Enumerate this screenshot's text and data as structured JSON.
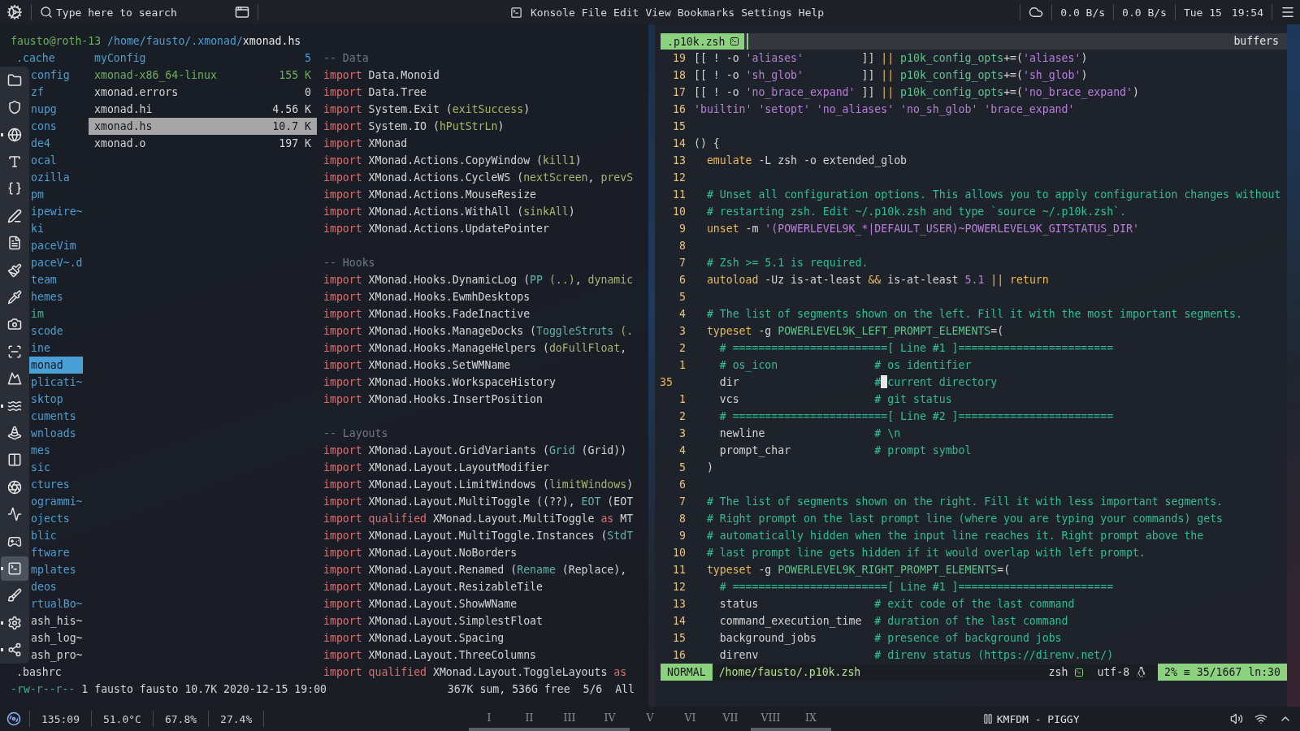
{
  "top_bar": {
    "search": {
      "placeholder": "Type here to search"
    },
    "app": "Konsole",
    "menu": [
      "File",
      "Edit",
      "View",
      "Bookmarks",
      "Settings",
      "Help"
    ],
    "net_down": "0.0 B/s",
    "net_up": "0.0 B/s",
    "date": "Tue 15",
    "time": "19:54"
  },
  "ranger": {
    "header": [
      {
        "kind": "user",
        "text": "fausto@roth-13"
      },
      {
        "kind": "path",
        "text": " /home/fausto/.xmonad/"
      },
      {
        "kind": "file",
        "text": "xmonad.hs"
      }
    ],
    "parent": [
      {
        "name": ".cache",
        "kind": "dir",
        "selected": false
      },
      {
        "name": "config",
        "kind": "dir",
        "selected": false
      },
      {
        "name": "zf",
        "kind": "dir",
        "selected": false
      },
      {
        "name": "nupg",
        "kind": "dir",
        "selected": false
      },
      {
        "name": "cons",
        "kind": "dir",
        "selected": false
      },
      {
        "name": "de4",
        "kind": "dir",
        "selected": false
      },
      {
        "name": "ocal",
        "kind": "dir",
        "selected": false
      },
      {
        "name": "ozilla",
        "kind": "dir",
        "selected": false
      },
      {
        "name": "pm",
        "kind": "dir",
        "selected": false
      },
      {
        "name": "ipewire~",
        "kind": "dir",
        "selected": false
      },
      {
        "name": "ki",
        "kind": "dir",
        "selected": false
      },
      {
        "name": "paceVim",
        "kind": "dir",
        "selected": false
      },
      {
        "name": "paceV~.d",
        "kind": "dir",
        "selected": false
      },
      {
        "name": "team",
        "kind": "dir",
        "selected": false
      },
      {
        "name": "hemes",
        "kind": "dir",
        "selected": false
      },
      {
        "name": "im",
        "kind": "link",
        "selected": false
      },
      {
        "name": "scode",
        "kind": "dir",
        "selected": false
      },
      {
        "name": "ine",
        "kind": "dir",
        "selected": false
      },
      {
        "name": "monad",
        "kind": "dir",
        "selected": true
      },
      {
        "name": "plicati~",
        "kind": "dir",
        "selected": false
      },
      {
        "name": "sktop",
        "kind": "dir",
        "selected": false
      },
      {
        "name": "cuments",
        "kind": "dir",
        "selected": false
      },
      {
        "name": "wnloads",
        "kind": "dir",
        "selected": false
      },
      {
        "name": "mes",
        "kind": "dir",
        "selected": false
      },
      {
        "name": "sic",
        "kind": "dir",
        "selected": false
      },
      {
        "name": "ctures",
        "kind": "dir",
        "selected": false
      },
      {
        "name": "ogrammi~",
        "kind": "dir",
        "selected": false
      },
      {
        "name": "ojects",
        "kind": "dir",
        "selected": false
      },
      {
        "name": "blic",
        "kind": "dir",
        "selected": false
      },
      {
        "name": "ftware",
        "kind": "dir",
        "selected": false
      },
      {
        "name": "mplates",
        "kind": "dir",
        "selected": false
      },
      {
        "name": "deos",
        "kind": "dir",
        "selected": false
      },
      {
        "name": "rtualBo~",
        "kind": "dir",
        "selected": false
      },
      {
        "name": "ash_his~",
        "kind": "file",
        "selected": false
      },
      {
        "name": "ash_log~",
        "kind": "file",
        "selected": false
      },
      {
        "name": "ash_pro~",
        "kind": "file",
        "selected": false
      },
      {
        "name": ".bashrc",
        "kind": "file",
        "selected": false
      }
    ],
    "dock": [
      {
        "selected": false,
        "running": false
      },
      {
        "selected": false,
        "running": false
      },
      {
        "selected": false,
        "running": true
      },
      {
        "selected": false,
        "running": false
      },
      {
        "selected": false,
        "running": false
      },
      {
        "selected": false,
        "running": false
      },
      {
        "selected": false,
        "running": false
      },
      {
        "selected": false,
        "running": false
      },
      {
        "selected": false,
        "running": false
      },
      {
        "selected": false,
        "running": false
      },
      {
        "selected": false,
        "running": false
      },
      {
        "selected": false,
        "running": false
      },
      {
        "selected": false,
        "running": true
      },
      {
        "selected": false,
        "running": false
      },
      {
        "selected": false,
        "running": false
      },
      {
        "selected": false,
        "running": false
      },
      {
        "selected": false,
        "running": false
      },
      {
        "selected": false,
        "running": false
      },
      {
        "selected": true,
        "running": true
      },
      {
        "selected": false,
        "running": false
      },
      {
        "selected": false,
        "running": true
      },
      {
        "selected": false,
        "running": true
      }
    ],
    "files": [
      {
        "name": "myConfig",
        "size": "5",
        "kind": "dir",
        "selected": false
      },
      {
        "name": "xmonad-x86_64-linux",
        "size": "155 K",
        "kind": "exec",
        "selected": false
      },
      {
        "name": "xmonad.errors",
        "size": "0",
        "kind": "file",
        "selected": false
      },
      {
        "name": "xmonad.hi",
        "size": "4.56 K",
        "kind": "file",
        "selected": false
      },
      {
        "name": "xmonad.hs",
        "size": "10.7 K",
        "kind": "file",
        "selected": true
      },
      {
        "name": "xmonad.o",
        "size": "197 K",
        "kind": "file",
        "selected": false
      }
    ],
    "preview": [
      {
        "kind": "code",
        "segs": [
          {
            "kind": "com",
            "text": "-- Data"
          }
        ]
      },
      {
        "kind": "code",
        "segs": [
          {
            "kind": "kw",
            "text": "import"
          },
          {
            "kind": "plain",
            "text": " Data.Monoid"
          }
        ]
      },
      {
        "kind": "code",
        "segs": [
          {
            "kind": "kw",
            "text": "import"
          },
          {
            "kind": "plain",
            "text": " Data.Tree"
          }
        ]
      },
      {
        "kind": "code",
        "segs": [
          {
            "kind": "kw",
            "text": "import"
          },
          {
            "kind": "plain",
            "text": " System.Exit ("
          },
          {
            "kind": "fn",
            "text": "exitSuccess"
          },
          {
            "kind": "plain",
            "text": ")"
          }
        ]
      },
      {
        "kind": "code",
        "segs": [
          {
            "kind": "kw",
            "text": "import"
          },
          {
            "kind": "plain",
            "text": " System.IO ("
          },
          {
            "kind": "fn",
            "text": "hPutStrLn"
          },
          {
            "kind": "plain",
            "text": ")"
          }
        ]
      },
      {
        "kind": "code",
        "segs": [
          {
            "kind": "kw",
            "text": "import"
          },
          {
            "kind": "plain",
            "text": " XMonad"
          }
        ]
      },
      {
        "kind": "code",
        "segs": [
          {
            "kind": "kw",
            "text": "import"
          },
          {
            "kind": "plain",
            "text": " XMonad.Actions.CopyWindow ("
          },
          {
            "kind": "fn",
            "text": "kill1"
          },
          {
            "kind": "plain",
            "text": ")"
          }
        ]
      },
      {
        "kind": "code",
        "segs": [
          {
            "kind": "kw",
            "text": "import"
          },
          {
            "kind": "plain",
            "text": " XMonad.Actions.CycleWS ("
          },
          {
            "kind": "fn",
            "text": "nextScreen"
          },
          {
            "kind": "plain",
            "text": ", "
          },
          {
            "kind": "fn",
            "text": "prevS"
          }
        ]
      },
      {
        "kind": "code",
        "segs": [
          {
            "kind": "kw",
            "text": "import"
          },
          {
            "kind": "plain",
            "text": " XMonad.Actions.MouseResize"
          }
        ]
      },
      {
        "kind": "code",
        "segs": [
          {
            "kind": "kw",
            "text": "import"
          },
          {
            "kind": "plain",
            "text": " XMonad.Actions.WithAll ("
          },
          {
            "kind": "fn",
            "text": "sinkAll"
          },
          {
            "kind": "plain",
            "text": ")"
          }
        ]
      },
      {
        "kind": "code",
        "segs": [
          {
            "kind": "kw",
            "text": "import"
          },
          {
            "kind": "plain",
            "text": " XMonad.Actions.UpdatePointer"
          }
        ]
      },
      {
        "kind": "blank"
      },
      {
        "kind": "code",
        "segs": [
          {
            "kind": "com",
            "text": "-- Hooks"
          }
        ]
      },
      {
        "kind": "code",
        "segs": [
          {
            "kind": "kw",
            "text": "import"
          },
          {
            "kind": "plain",
            "text": " XMonad.Hooks.DynamicLog ("
          },
          {
            "kind": "ctor",
            "text": "PP"
          },
          {
            "kind": "fn",
            "text": " (..)"
          },
          {
            "kind": "plain",
            "text": ", "
          },
          {
            "kind": "fn",
            "text": "dynamic"
          }
        ]
      },
      {
        "kind": "code",
        "segs": [
          {
            "kind": "kw",
            "text": "import"
          },
          {
            "kind": "plain",
            "text": " XMonad.Hooks.EwmhDesktops"
          }
        ]
      },
      {
        "kind": "code",
        "segs": [
          {
            "kind": "kw",
            "text": "import"
          },
          {
            "kind": "plain",
            "text": " XMonad.Hooks.FadeInactive"
          }
        ]
      },
      {
        "kind": "code",
        "segs": [
          {
            "kind": "kw",
            "text": "import"
          },
          {
            "kind": "plain",
            "text": " XMonad.Hooks.ManageDocks ("
          },
          {
            "kind": "ctor",
            "text": "ToggleStruts"
          },
          {
            "kind": "fn",
            "text": " (."
          }
        ]
      },
      {
        "kind": "code",
        "segs": [
          {
            "kind": "kw",
            "text": "import"
          },
          {
            "kind": "plain",
            "text": " XMonad.Hooks.ManageHelpers ("
          },
          {
            "kind": "fn",
            "text": "doFullFloat"
          },
          {
            "kind": "plain",
            "text": ","
          }
        ]
      },
      {
        "kind": "code",
        "segs": [
          {
            "kind": "kw",
            "text": "import"
          },
          {
            "kind": "plain",
            "text": " XMonad.Hooks.SetWMName"
          }
        ]
      },
      {
        "kind": "code",
        "segs": [
          {
            "kind": "kw",
            "text": "import"
          },
          {
            "kind": "plain",
            "text": " XMonad.Hooks.WorkspaceHistory"
          }
        ]
      },
      {
        "kind": "code",
        "segs": [
          {
            "kind": "kw",
            "text": "import"
          },
          {
            "kind": "plain",
            "text": " XMonad.Hooks.InsertPosition"
          }
        ]
      },
      {
        "kind": "blank"
      },
      {
        "kind": "code",
        "segs": [
          {
            "kind": "com",
            "text": "-- Layouts"
          }
        ]
      },
      {
        "kind": "code",
        "segs": [
          {
            "kind": "kw",
            "text": "import"
          },
          {
            "kind": "plain",
            "text": " XMonad.Layout.GridVariants ("
          },
          {
            "kind": "ctor",
            "text": "Grid"
          },
          {
            "kind": "plain",
            "text": " (Grid))"
          }
        ]
      },
      {
        "kind": "code",
        "segs": [
          {
            "kind": "kw",
            "text": "import"
          },
          {
            "kind": "plain",
            "text": " XMonad.Layout.LayoutModifier"
          }
        ]
      },
      {
        "kind": "code",
        "segs": [
          {
            "kind": "kw",
            "text": "import"
          },
          {
            "kind": "plain",
            "text": " XMonad.Layout.LimitWindows ("
          },
          {
            "kind": "fn",
            "text": "limitWindows"
          },
          {
            "kind": "plain",
            "text": ")"
          }
        ]
      },
      {
        "kind": "code",
        "segs": [
          {
            "kind": "kw",
            "text": "import"
          },
          {
            "kind": "plain",
            "text": " XMonad.Layout.MultiToggle ((??), "
          },
          {
            "kind": "ctor",
            "text": "EOT"
          },
          {
            "kind": "plain",
            "text": " (EOT"
          }
        ]
      },
      {
        "kind": "code",
        "segs": [
          {
            "kind": "kw",
            "text": "import qualified"
          },
          {
            "kind": "plain",
            "text": " XMonad.Layout.MultiToggle "
          },
          {
            "kind": "kw",
            "text": "as"
          },
          {
            "kind": "plain",
            "text": " MT"
          }
        ]
      },
      {
        "kind": "code",
        "segs": [
          {
            "kind": "kw",
            "text": "import"
          },
          {
            "kind": "plain",
            "text": " XMonad.Layout.MultiToggle.Instances ("
          },
          {
            "kind": "ctor",
            "text": "StdT"
          }
        ]
      },
      {
        "kind": "code",
        "segs": [
          {
            "kind": "kw",
            "text": "import"
          },
          {
            "kind": "plain",
            "text": " XMonad.Layout.NoBorders"
          }
        ]
      },
      {
        "kind": "code",
        "segs": [
          {
            "kind": "kw",
            "text": "import"
          },
          {
            "kind": "plain",
            "text": " XMonad.Layout.Renamed ("
          },
          {
            "kind": "ctor",
            "text": "Rename"
          },
          {
            "kind": "plain",
            "text": " (Replace),"
          }
        ]
      },
      {
        "kind": "code",
        "segs": [
          {
            "kind": "kw",
            "text": "import"
          },
          {
            "kind": "plain",
            "text": " XMonad.Layout.ResizableTile"
          }
        ]
      },
      {
        "kind": "code",
        "segs": [
          {
            "kind": "kw",
            "text": "import"
          },
          {
            "kind": "plain",
            "text": " XMonad.Layout.ShowWName"
          }
        ]
      },
      {
        "kind": "code",
        "segs": [
          {
            "kind": "kw",
            "text": "import"
          },
          {
            "kind": "plain",
            "text": " XMonad.Layout.SimplestFloat"
          }
        ]
      },
      {
        "kind": "code",
        "segs": [
          {
            "kind": "kw",
            "text": "import"
          },
          {
            "kind": "plain",
            "text": " XMonad.Layout.Spacing"
          }
        ]
      },
      {
        "kind": "code",
        "segs": [
          {
            "kind": "kw",
            "text": "import"
          },
          {
            "kind": "plain",
            "text": " XMonad.Layout.ThreeColumns"
          }
        ]
      },
      {
        "kind": "code",
        "segs": [
          {
            "kind": "kw",
            "text": "import qualified"
          },
          {
            "kind": "plain",
            "text": " XMonad.Layout.ToggleLayouts "
          },
          {
            "kind": "kw",
            "text": "as"
          }
        ]
      }
    ],
    "status": {
      "left": [
        {
          "kind": "perm",
          "text": "-rw-r--r--"
        },
        {
          "kind": "plain",
          "text": " 1 fausto fausto 10.7K 2020-12-15 19:00"
        }
      ],
      "right": "367K sum, 536G free  5/6  All"
    }
  },
  "vim": {
    "tab": ".p10k.zsh",
    "buffers": "buffers",
    "lines": [
      {
        "num": "19",
        "current": false,
        "kind": "code",
        "segs": [
          {
            "kind": "plain",
            "text": "[[ ! -o "
          },
          {
            "kind": "str",
            "text": "'aliases'"
          },
          {
            "kind": "plain",
            "text": "         ]] "
          },
          {
            "kind": "op",
            "text": "|| "
          },
          {
            "kind": "var",
            "text": "p10k_config_opts"
          },
          {
            "kind": "plain",
            "text": "+=("
          },
          {
            "kind": "str",
            "text": "'aliases'"
          },
          {
            "kind": "plain",
            "text": ")"
          }
        ]
      },
      {
        "num": "18",
        "current": false,
        "kind": "code",
        "segs": [
          {
            "kind": "plain",
            "text": "[[ ! -o "
          },
          {
            "kind": "str",
            "text": "'sh_glob'"
          },
          {
            "kind": "plain",
            "text": "         ]] "
          },
          {
            "kind": "op",
            "text": "|| "
          },
          {
            "kind": "var",
            "text": "p10k_config_opts"
          },
          {
            "kind": "plain",
            "text": "+=("
          },
          {
            "kind": "str",
            "text": "'sh_glob'"
          },
          {
            "kind": "plain",
            "text": ")"
          }
        ]
      },
      {
        "num": "17",
        "current": false,
        "kind": "code",
        "segs": [
          {
            "kind": "plain",
            "text": "[[ ! -o "
          },
          {
            "kind": "str",
            "text": "'no_brace_expand'"
          },
          {
            "kind": "plain",
            "text": " ]] "
          },
          {
            "kind": "op",
            "text": "|| "
          },
          {
            "kind": "var",
            "text": "p10k_config_opts"
          },
          {
            "kind": "plain",
            "text": "+=("
          },
          {
            "kind": "str",
            "text": "'no_brace_expand'"
          },
          {
            "kind": "plain",
            "text": ")"
          }
        ]
      },
      {
        "num": "16",
        "current": false,
        "kind": "code",
        "segs": [
          {
            "kind": "str",
            "text": "'builtin' 'setopt' 'no_aliases' 'no_sh_glob' 'brace_expand'"
          }
        ]
      },
      {
        "num": "15",
        "current": false,
        "kind": "blank"
      },
      {
        "num": "14",
        "current": false,
        "kind": "code",
        "segs": [
          {
            "kind": "plain",
            "text": "() {"
          }
        ]
      },
      {
        "num": "13",
        "current": false,
        "kind": "code",
        "segs": [
          {
            "kind": "kw",
            "text": "  emulate"
          },
          {
            "kind": "plain",
            "text": " -L zsh -o extended_glob"
          }
        ]
      },
      {
        "num": "12",
        "current": false,
        "kind": "blank"
      },
      {
        "num": "11",
        "current": false,
        "kind": "code",
        "segs": [
          {
            "kind": "com",
            "text": "  # Unset all configuration options. This allows you to apply configuration changes without"
          }
        ]
      },
      {
        "num": "10",
        "current": false,
        "kind": "code",
        "segs": [
          {
            "kind": "com",
            "text": "  # restarting zsh. Edit ~/.p10k.zsh and type `source ~/.p10k.zsh`."
          }
        ]
      },
      {
        "num": "9",
        "current": false,
        "kind": "code",
        "segs": [
          {
            "kind": "kw",
            "text": "  unset"
          },
          {
            "kind": "plain",
            "text": " -m "
          },
          {
            "kind": "str",
            "text": "'(POWERLEVEL9K_*|DEFAULT_USER)~POWERLEVEL9K_GITSTATUS_DIR'"
          }
        ]
      },
      {
        "num": "8",
        "current": false,
        "kind": "blank"
      },
      {
        "num": "7",
        "current": false,
        "kind": "code",
        "segs": [
          {
            "kind": "com",
            "text": "  # Zsh >= 5.1 is required."
          }
        ]
      },
      {
        "num": "6",
        "current": false,
        "kind": "code",
        "segs": [
          {
            "kind": "kw",
            "text": "  autoload"
          },
          {
            "kind": "plain",
            "text": " -Uz is-at-least "
          },
          {
            "kind": "op",
            "text": "&&"
          },
          {
            "kind": "plain",
            "text": " is-at-least "
          },
          {
            "kind": "str",
            "text": "5.1 "
          },
          {
            "kind": "op",
            "text": "|| "
          },
          {
            "kind": "kw",
            "text": "return"
          }
        ]
      },
      {
        "num": "5",
        "current": false,
        "kind": "blank"
      },
      {
        "num": "4",
        "current": false,
        "kind": "code",
        "segs": [
          {
            "kind": "com",
            "text": "  # The list of segments shown on the left. Fill it with the most important segments."
          }
        ]
      },
      {
        "num": "3",
        "current": false,
        "kind": "code",
        "segs": [
          {
            "kind": "kw",
            "text": "  typeset"
          },
          {
            "kind": "plain",
            "text": " -g "
          },
          {
            "kind": "var",
            "text": "POWERLEVEL9K_LEFT_PROMPT_ELEMENTS"
          },
          {
            "kind": "plain",
            "text": "=("
          }
        ]
      },
      {
        "num": "2",
        "current": false,
        "kind": "code",
        "segs": [
          {
            "kind": "com",
            "text": "    # ========================[ Line #1 ]========================"
          }
        ]
      },
      {
        "num": "1",
        "current": false,
        "kind": "code",
        "segs": [
          {
            "kind": "com",
            "text": "    # os_icon               # os identifier"
          }
        ]
      },
      {
        "num": "35",
        "current": true,
        "kind": "code",
        "segs": [
          {
            "kind": "plain",
            "text": "    dir                     "
          },
          {
            "kind": "com",
            "text": "#"
          },
          {
            "kind": "cursor"
          },
          {
            "kind": "com",
            "text": "current directory"
          }
        ]
      },
      {
        "num": "1",
        "current": false,
        "kind": "code",
        "segs": [
          {
            "kind": "plain",
            "text": "    vcs                     "
          },
          {
            "kind": "com",
            "text": "# git status"
          }
        ]
      },
      {
        "num": "2",
        "current": false,
        "kind": "code",
        "segs": [
          {
            "kind": "com",
            "text": "    # ========================[ Line #2 ]========================"
          }
        ]
      },
      {
        "num": "3",
        "current": false,
        "kind": "code",
        "segs": [
          {
            "kind": "plain",
            "text": "    newline                 "
          },
          {
            "kind": "com",
            "text": "# \\n"
          }
        ]
      },
      {
        "num": "4",
        "current": false,
        "kind": "code",
        "segs": [
          {
            "kind": "plain",
            "text": "    prompt_char             "
          },
          {
            "kind": "com",
            "text": "# prompt symbol"
          }
        ]
      },
      {
        "num": "5",
        "current": false,
        "kind": "code",
        "segs": [
          {
            "kind": "plain",
            "text": "  )"
          }
        ]
      },
      {
        "num": "6",
        "current": false,
        "kind": "blank"
      },
      {
        "num": "7",
        "current": false,
        "kind": "code",
        "segs": [
          {
            "kind": "com",
            "text": "  # The list of segments shown on the right. Fill it with less important segments."
          }
        ]
      },
      {
        "num": "8",
        "current": false,
        "kind": "code",
        "segs": [
          {
            "kind": "com",
            "text": "  # Right prompt on the last prompt line (where you are typing your commands) gets"
          }
        ]
      },
      {
        "num": "9",
        "current": false,
        "kind": "code",
        "segs": [
          {
            "kind": "com",
            "text": "  # automatically hidden when the input line reaches it. Right prompt above the"
          }
        ]
      },
      {
        "num": "10",
        "current": false,
        "kind": "code",
        "segs": [
          {
            "kind": "com",
            "text": "  # last prompt line gets hidden if it would overlap with left prompt."
          }
        ]
      },
      {
        "num": "11",
        "current": false,
        "kind": "code",
        "segs": [
          {
            "kind": "kw",
            "text": "  typeset"
          },
          {
            "kind": "plain",
            "text": " -g "
          },
          {
            "kind": "var",
            "text": "POWERLEVEL9K_RIGHT_PROMPT_ELEMENTS"
          },
          {
            "kind": "plain",
            "text": "=("
          }
        ]
      },
      {
        "num": "12",
        "current": false,
        "kind": "code",
        "segs": [
          {
            "kind": "com",
            "text": "    # ========================[ Line #1 ]========================"
          }
        ]
      },
      {
        "num": "13",
        "current": false,
        "kind": "code",
        "segs": [
          {
            "kind": "plain",
            "text": "    status                  "
          },
          {
            "kind": "com",
            "text": "# exit code of the last command"
          }
        ]
      },
      {
        "num": "14",
        "current": false,
        "kind": "code",
        "segs": [
          {
            "kind": "plain",
            "text": "    command_execution_time  "
          },
          {
            "kind": "com",
            "text": "# duration of the last command"
          }
        ]
      },
      {
        "num": "15",
        "current": false,
        "kind": "code",
        "segs": [
          {
            "kind": "plain",
            "text": "    background_jobs         "
          },
          {
            "kind": "com",
            "text": "# presence of background jobs"
          }
        ]
      },
      {
        "num": "16",
        "current": false,
        "kind": "code",
        "segs": [
          {
            "kind": "plain",
            "text": "    direnv                  "
          },
          {
            "kind": "com",
            "text": "# direnv status (https://direnv.net/)"
          }
        ]
      }
    ],
    "statusline": {
      "mode": "NORMAL",
      "file": "/home/fausto/.p10k.zsh",
      "filetype": "zsh",
      "encoding": "utf-8",
      "position": "2% ≡ 35/1667 ln:30"
    }
  },
  "bottom_bar": {
    "stats": [
      "135:09",
      "51.0°C",
      "67.8%",
      "27.4%"
    ],
    "workspaces": [
      {
        "label": "I",
        "occupied": true
      },
      {
        "label": "II",
        "occupied": true
      },
      {
        "label": "III",
        "occupied": true
      },
      {
        "label": "IV",
        "occupied": true
      },
      {
        "label": "V",
        "occupied": false
      },
      {
        "label": "VI",
        "occupied": false
      },
      {
        "label": "VII",
        "occupied": false
      },
      {
        "label": "VIII",
        "occupied": true
      },
      {
        "label": "IX",
        "occupied": true
      }
    ],
    "now_playing": "KMFDM - PIGGY"
  }
}
